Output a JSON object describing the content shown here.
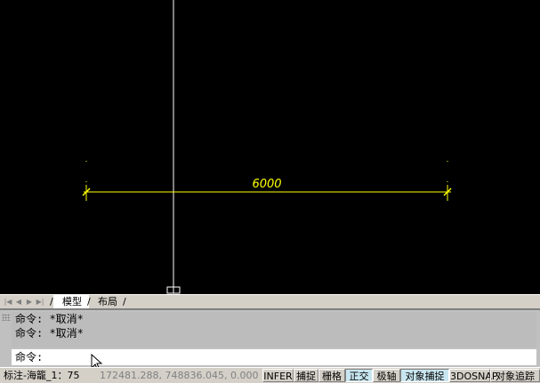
{
  "drawing": {
    "dimension_text": "6000",
    "line_color": "#ffff00",
    "crosshair_color": "#ffffff"
  },
  "tabs": {
    "nav_first": "|◀",
    "nav_prev": "◀",
    "nav_next": "▶",
    "nav_last": "▶|",
    "model": "模型",
    "layout": "布局"
  },
  "command": {
    "history": [
      "命令: *取消*",
      "命令: *取消*"
    ],
    "prompt": "命令:",
    "value": ""
  },
  "status": {
    "scale": "标注-海籠_1：75",
    "coords": "172481.288, 748836.045, 0.000",
    "buttons": [
      {
        "label": "INFER",
        "on": false
      },
      {
        "label": "捕捉",
        "on": false
      },
      {
        "label": "栅格",
        "on": false
      },
      {
        "label": "正交",
        "on": true
      },
      {
        "label": "极轴",
        "on": false
      },
      {
        "label": "对象捕捉",
        "on": true
      },
      {
        "label": "3DOSNAP",
        "on": false
      },
      {
        "label": "对象追踪",
        "on": false
      }
    ]
  }
}
